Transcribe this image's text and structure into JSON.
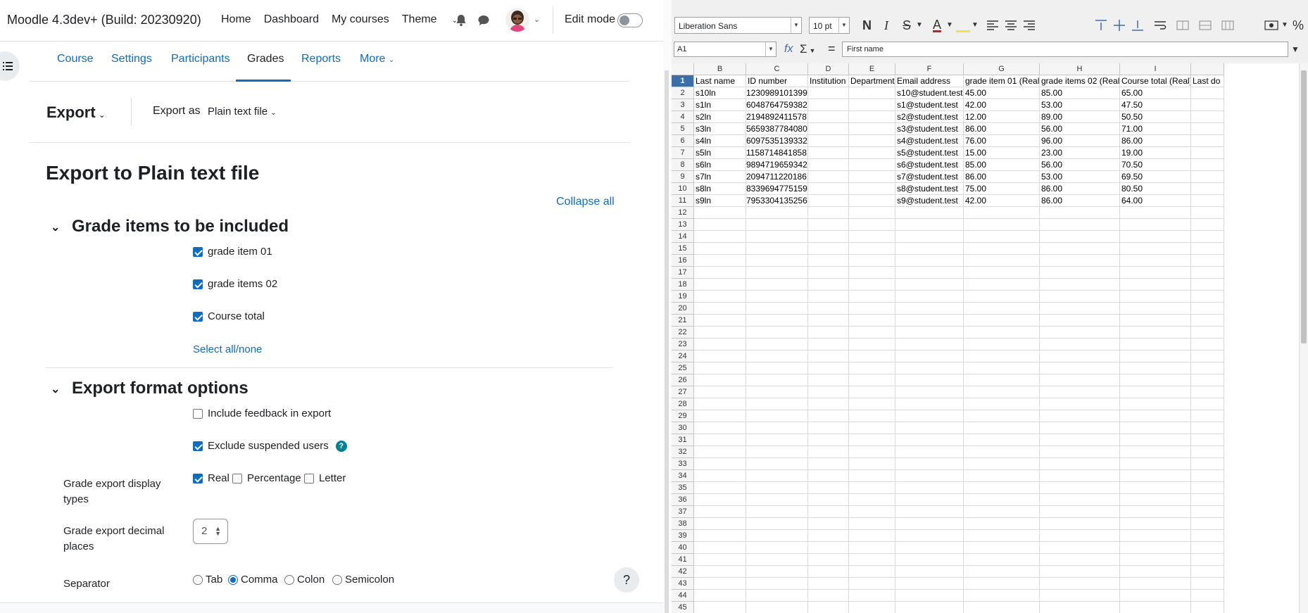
{
  "moodle": {
    "brand": "Moodle 4.3dev+ (Build: 20230920)",
    "nav": {
      "home": "Home",
      "dashboard": "Dashboard",
      "my_courses": "My courses",
      "theme": "Theme"
    },
    "edit_mode": "Edit mode",
    "tabs": [
      "Course",
      "Settings",
      "Participants",
      "Grades",
      "Reports",
      "More"
    ],
    "export_menu": "Export",
    "export_as_label": "Export as",
    "export_as_value": "Plain text file",
    "page_title": "Export to Plain text file",
    "collapse_all": "Collapse all",
    "section_grade_items": "Grade items to be included",
    "grade_items": [
      {
        "label": "grade item 01",
        "checked": true
      },
      {
        "label": "grade items 02",
        "checked": true
      },
      {
        "label": "Course total",
        "checked": true
      }
    ],
    "select_all": "Select all/none",
    "section_format": "Export format options",
    "include_feedback": "Include feedback in export",
    "exclude_suspended": "Exclude suspended users",
    "display_types_label": "Grade export display types",
    "display_types": [
      "Real",
      "Percentage",
      "Letter"
    ],
    "decimal_places_label": "Grade export decimal places",
    "decimal_places_value": "2",
    "separator_label": "Separator",
    "separators": [
      "Tab",
      "Comma",
      "Colon",
      "Semicolon"
    ],
    "help_fab": "?"
  },
  "calc": {
    "font_name": "Liberation Sans",
    "font_size": "10 pt",
    "cell_ref": "A1",
    "formula_value": "First name",
    "columns": [
      {
        "letter": "B",
        "header": "Last name"
      },
      {
        "letter": "C",
        "header": "ID number"
      },
      {
        "letter": "D",
        "header": "Institution"
      },
      {
        "letter": "E",
        "header": "Department"
      },
      {
        "letter": "F",
        "header": "Email address"
      },
      {
        "letter": "G",
        "header": "grade item 01 (Real)"
      },
      {
        "letter": "H",
        "header": "grade items 02 (Real)"
      },
      {
        "letter": "I",
        "header": "Course total (Real)"
      },
      {
        "letter": "",
        "header": "Last do"
      }
    ],
    "rows": [
      [
        "s10ln",
        "1230989101399",
        "",
        "",
        "s10@student.test",
        "45.00",
        "85.00",
        "65.00",
        ""
      ],
      [
        "s1ln",
        "6048764759382",
        "",
        "",
        "s1@student.test",
        "42.00",
        "53.00",
        "47.50",
        ""
      ],
      [
        "s2ln",
        "2194892411578",
        "",
        "",
        "s2@student.test",
        "12.00",
        "89.00",
        "50.50",
        ""
      ],
      [
        "s3ln",
        "5659387784080",
        "",
        "",
        "s3@student.test",
        "86.00",
        "56.00",
        "71.00",
        ""
      ],
      [
        "s4ln",
        "6097535139332",
        "",
        "",
        "s4@student.test",
        "76.00",
        "96.00",
        "86.00",
        ""
      ],
      [
        "s5ln",
        "1158714841858",
        "",
        "",
        "s5@student.test",
        "15.00",
        "23.00",
        "19.00",
        ""
      ],
      [
        "s6ln",
        "9894719659342",
        "",
        "",
        "s6@student.test",
        "85.00",
        "56.00",
        "70.50",
        ""
      ],
      [
        "s7ln",
        "2094711220186",
        "",
        "",
        "s7@student.test",
        "86.00",
        "53.00",
        "69.50",
        ""
      ],
      [
        "s8ln",
        "8339694775159",
        "",
        "",
        "s8@student.test",
        "75.00",
        "86.00",
        "80.50",
        ""
      ],
      [
        "s9ln",
        "7953304135256",
        "",
        "",
        "s9@student.test",
        "42.00",
        "86.00",
        "64.00",
        ""
      ]
    ],
    "row_numbers_total": 45
  }
}
